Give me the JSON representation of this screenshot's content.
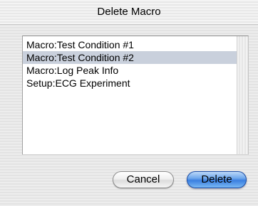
{
  "dialog": {
    "title": "Delete Macro"
  },
  "list": {
    "items": [
      {
        "label": "Macro:Test Condition #1",
        "selected": false
      },
      {
        "label": "Macro:Test Condition #2",
        "selected": true
      },
      {
        "label": "Macro:Log Peak Info",
        "selected": false
      },
      {
        "label": "Setup:ECG Experiment",
        "selected": false
      }
    ]
  },
  "buttons": {
    "cancel_label": "Cancel",
    "delete_label": "Delete"
  },
  "colors": {
    "selection": "#c9d0dc",
    "default_button": "#3a7fe0"
  }
}
